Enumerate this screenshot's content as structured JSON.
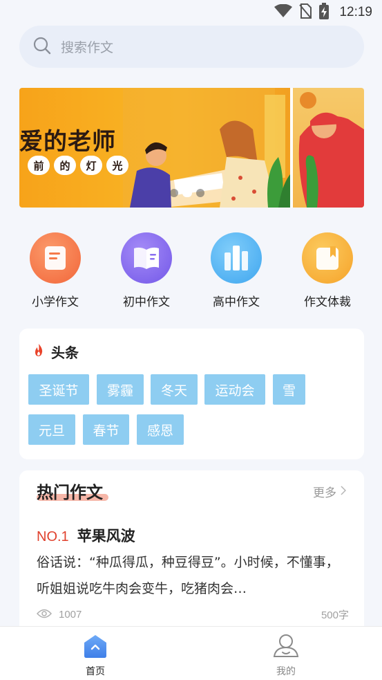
{
  "status_bar": {
    "time": "12:19",
    "icons": [
      "wifi-icon",
      "no-sim-icon",
      "battery-charging-icon"
    ]
  },
  "search": {
    "placeholder": "搜索作文",
    "icon": "search-icon"
  },
  "banner": {
    "title": "爱的老师",
    "chips": [
      "前",
      "的",
      "灯",
      "光"
    ],
    "page_count": 3,
    "active_page": 2
  },
  "categories": [
    {
      "label": "小学作文",
      "icon": "document-icon",
      "color": "#f57a4a"
    },
    {
      "label": "初中作文",
      "icon": "book-icon",
      "color": "#8a6ff0"
    },
    {
      "label": "高中作文",
      "icon": "books-icon",
      "color": "#5bb8f5"
    },
    {
      "label": "作文体裁",
      "icon": "bookmark-note-icon",
      "color": "#f7b23c"
    }
  ],
  "headlines": {
    "title": "头条",
    "icon": "flame-icon",
    "tags": [
      "圣诞节",
      "雾霾",
      "冬天",
      "运动会",
      "雪",
      "元旦",
      "春节",
      "感恩"
    ]
  },
  "hot_essays": {
    "title": "热门作文",
    "more_label": "更多",
    "items": [
      {
        "rank": "NO.1",
        "title": "苹果风波",
        "excerpt": "俗话说：“种瓜得瓜，种豆得豆”。小时候，不懂事，听姐姐说吃牛肉会变牛，吃猪肉会…",
        "views": "1007",
        "word_count": "500字"
      }
    ]
  },
  "bottom_nav": {
    "items": [
      {
        "label": "首页",
        "icon": "home-icon",
        "active": true
      },
      {
        "label": "我的",
        "icon": "profile-icon",
        "active": false
      }
    ]
  },
  "colors": {
    "accent": "#4a8ff2",
    "tag_bg": "#8ecdf1",
    "rank_red": "#e0412d"
  }
}
